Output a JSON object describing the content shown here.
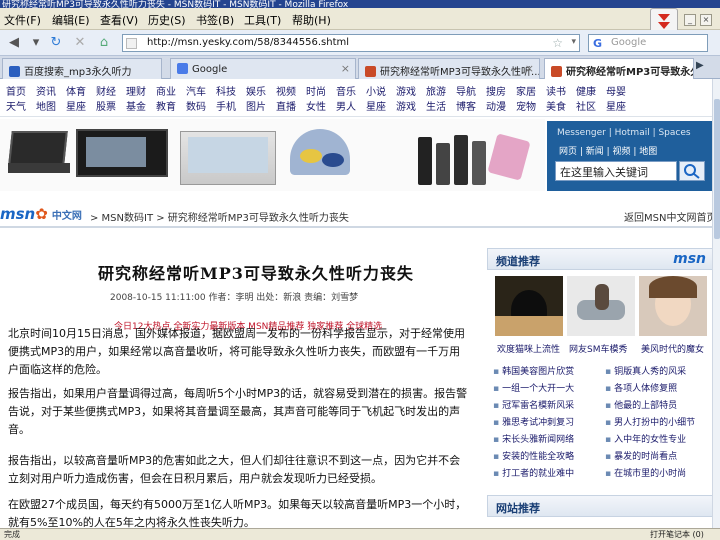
{
  "window": {
    "title": "研究称经常听MP3可导致永久性听力丧失 - MSN数码IT - MSN数码IT - Mozilla Firefox"
  },
  "menu": {
    "items": [
      "文件(F)",
      "编辑(E)",
      "查看(V)",
      "历史(S)",
      "书签(B)",
      "工具(T)",
      "帮助(H)"
    ]
  },
  "nav": {
    "url": "http://msn.yesky.com/58/8344556.shtml",
    "search_placeholder": "Google"
  },
  "tabs": [
    {
      "label": "百度搜索_mp3永久听力",
      "icon_color": "#2b5fbf"
    },
    {
      "label": "Google",
      "icon_color": "#4a7be8"
    },
    {
      "label": "研究称经常听MP3可导致永久性听...",
      "icon_color": "#c94a27"
    },
    {
      "label": "研究称经常听MP3可导致永久性...",
      "icon_color": "#c94a27"
    }
  ],
  "catnav": {
    "row1": [
      "首页",
      "资讯",
      "体育",
      "财经",
      "理财",
      "商业",
      "汽车",
      "科技",
      "娱乐",
      "视频",
      "时尚",
      "音乐",
      "小说",
      "游戏",
      "旅游",
      "导航",
      "搜房",
      "家居",
      "读书",
      "健康",
      "母婴"
    ],
    "row2": [
      "天气",
      "地图",
      "星座",
      "股票",
      "基金",
      "教育",
      "数码",
      "手机",
      "图片",
      "直播",
      "女性",
      "男人",
      "星座",
      "游戏",
      "生活",
      "博客",
      "动漫",
      "宠物",
      "美食",
      "社区",
      "星座"
    ]
  },
  "msn_widget": {
    "tabs_row1": "Messenger | Hotmail | Spaces",
    "tabs_row2": "网页 | 新闻 | 视频 | 地图",
    "search_value": "在这里输入关键词"
  },
  "breadcrumb": {
    "logo": "msn",
    "logo_cn": "中文网",
    "path": "> MSN数码IT > 研究称经常听MP3可导致永久性听力丧失",
    "right_link": "返回MSN中文网首页"
  },
  "article": {
    "title": "研究称经常听MP3可导致永久性听力丧失",
    "meta": "2008-10-15 11:11:00  作者：李明  出处：新浪  责编：刘雪梦",
    "links": "今日12大热点 全新实力最新版本   MSN精品推荐 独家推荐 全球精选",
    "paragraphs": [
      "北京时间10月15日消息，国外媒体报道，据欧盟周一发布的一份科学报告显示，对于经常使用便携式MP3的用户，如果经常以高音量收听，将可能导致永久性听力丧失，而欧盟有一千万用户面临这样的危险。",
      "报告指出，如果用户音量调得过高，每周听5个小时MP3的话，就容易受到潜在的损害。报告警告说，对于某些便携式MP3，如果将其音量调至最高，其声音可能等同于飞机起飞时发出的声音。",
      "报告指出，以较高音量听MP3的危害如此之大，但人们却往往意识不到这一点，因为它并不会立刻对用户听力造成伤害，但会在日积月累后，用户就会发现听力已经受损。",
      "在欧盟27个成员国，每天约有5000万至1亿人听MP3。如果每天以较高音量听MP3一个小时，就有5%至10%的人在5年之内将永久性丧失听力。"
    ]
  },
  "sidebar": {
    "heading": "频道推荐",
    "logo": "msn",
    "thumbs": [
      {
        "caption": "欢度猫咪上流性"
      },
      {
        "caption": "网友SM车模秀"
      },
      {
        "caption": "美风时代的魔女"
      }
    ],
    "news": [
      "韩国美容图片欣赏",
      "一组一个大开一大",
      "冠军雷名模新风采",
      "雅思考试冲刺复习",
      "宋长头雅新闻网络",
      "安装的性能全攻略",
      "打工者的就业难中",
      "铜版真人秀的风采",
      "各项人体修复照",
      "他最的上部特员",
      "男人打扮中的小细节",
      "入中年的女性专业",
      "暴发的时尚看点",
      "在城市里的小时尚"
    ],
    "heading2": "网站推荐"
  },
  "status": {
    "left": "完成",
    "right": "打开笔记本 (0)"
  }
}
